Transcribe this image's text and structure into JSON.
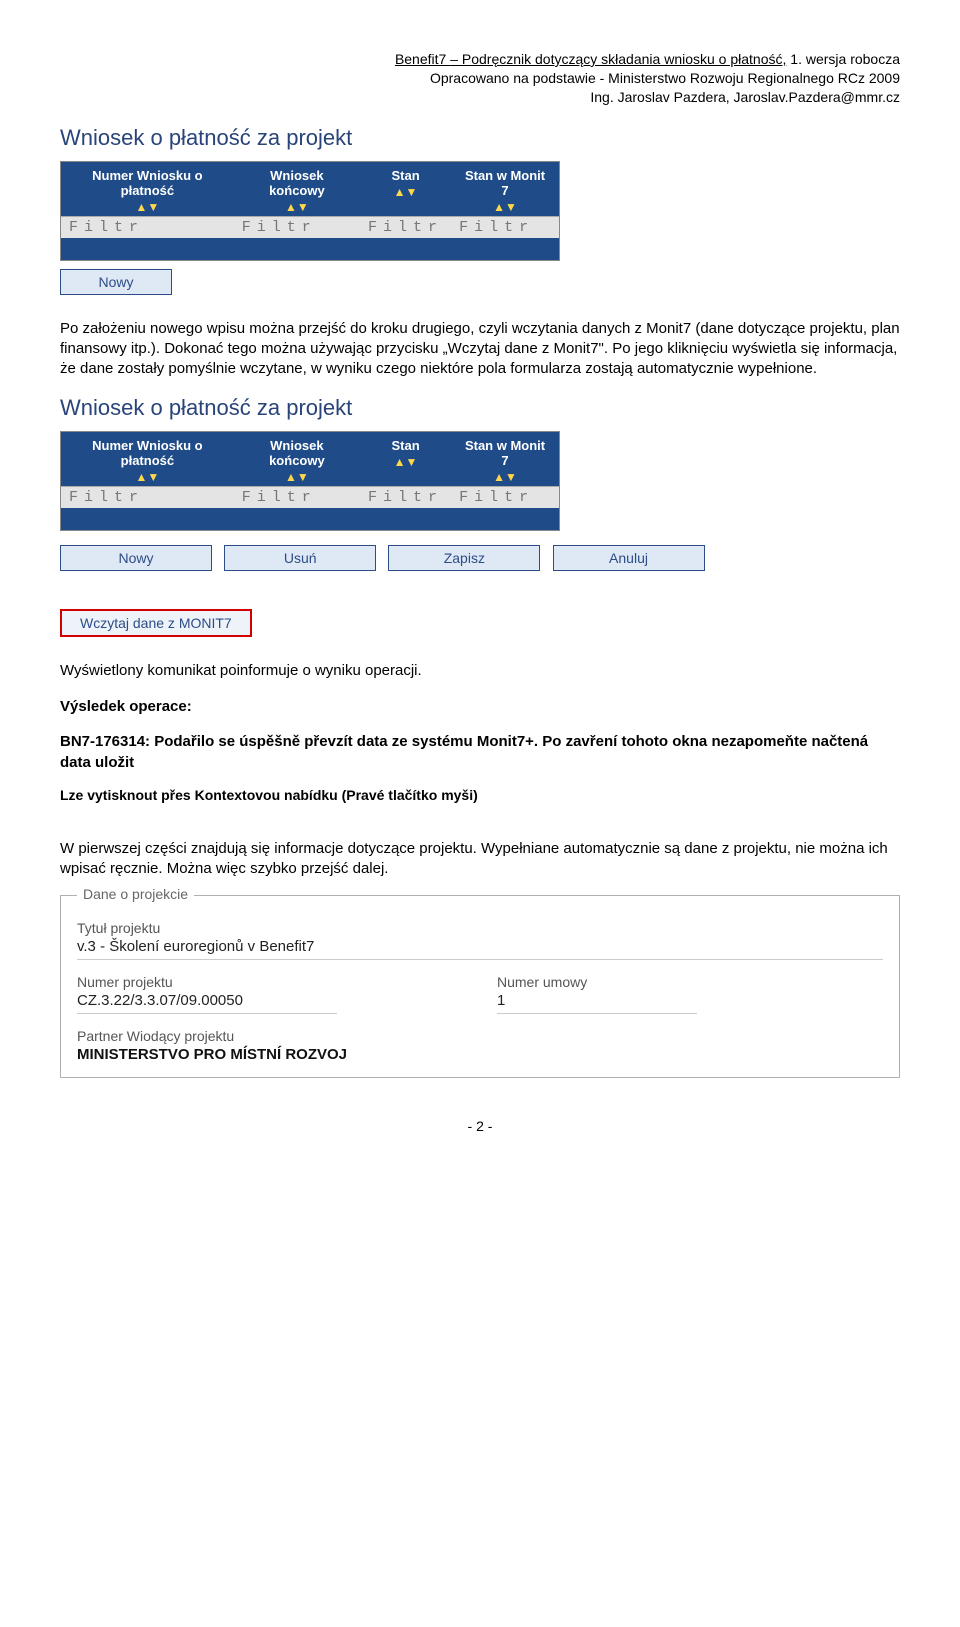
{
  "header": {
    "line1_a": "Benefit7 ",
    "line1_b": "– Podręcznik dotyczący składania wniosku o płatność,",
    "line1_c": " 1. wersja robocza",
    "line2": "Opracowano na podstawie - Ministerstwo Rozwoju Regionalnego RCz 2009",
    "line3": "Ing. Jaroslav Pazdera, Jaroslav.Pazdera@mmr.cz"
  },
  "section1": {
    "title": "Wniosek o płatność za projekt",
    "cols": {
      "c1": "Numer Wniosku o płatność",
      "c2": "Wniosek końcowy",
      "c3": "Stan",
      "c4": "Stan w Monit 7"
    },
    "filter": "Filtr",
    "sort": "▲▼",
    "btn_nowy": "Nowy"
  },
  "para1": "Po założeniu nowego wpisu można przejść do kroku drugiego, czyli wczytania danych z Monit7 (dane dotyczące projektu, plan finansowy itp.). Dokonać tego można używając przycisku „Wczytaj dane z Monit7\". Po jego kliknięciu wyświetla się informacja, że dane zostały pomyślnie wczytane, w wyniku czego niektóre pola formularza zostają automatycznie wypełnione.",
  "section2": {
    "title": "Wniosek o płatność za projekt",
    "cols": {
      "c1": "Numer Wniosku o płatność",
      "c2": "Wniosek końcowy",
      "c3": "Stan",
      "c4": "Stan w Monit 7"
    },
    "filter": "Filtr",
    "sort": "▲▼",
    "btns": {
      "nowy": "Nowy",
      "usun": "Usuń",
      "zapisz": "Zapisz",
      "anuluj": "Anuluj"
    },
    "btn_load": "Wczytaj dane z MONIT7"
  },
  "para2": "Wyświetlony komunikat poinformuje o wyniku operacji.",
  "result": {
    "title": "Výsledek operace:",
    "body": "BN7-176314: Podařilo se úspěšně převzít data ze systému Monit7+. Po zavření tohoto okna nezapomeňte načtená data uložit",
    "tip": "Lze vytisknout přes Kontextovou nabídku (Pravé tlačítko myši)"
  },
  "para3": "W pierwszej części znajdują się informacje dotyczące projektu. Wypełniane automatycznie są dane z projektu, nie można ich wpisać ręcznie. Można więc szybko przejść dalej.",
  "fieldset": {
    "legend": "Dane o projekcie",
    "title_label": "Tytuł projektu",
    "title_val": "v.3 - Školení euroregionů v Benefit7",
    "projnum_label": "Numer projektu",
    "projnum_val": "CZ.3.22/3.3.07/09.00050",
    "contractnum_label": "Numer umowy",
    "contractnum_val": "1",
    "partner_label": "Partner Wiodący projektu",
    "partner_val": "MINISTERSTVO PRO MÍSTNÍ ROZVOJ"
  },
  "footer": "- 2 -"
}
